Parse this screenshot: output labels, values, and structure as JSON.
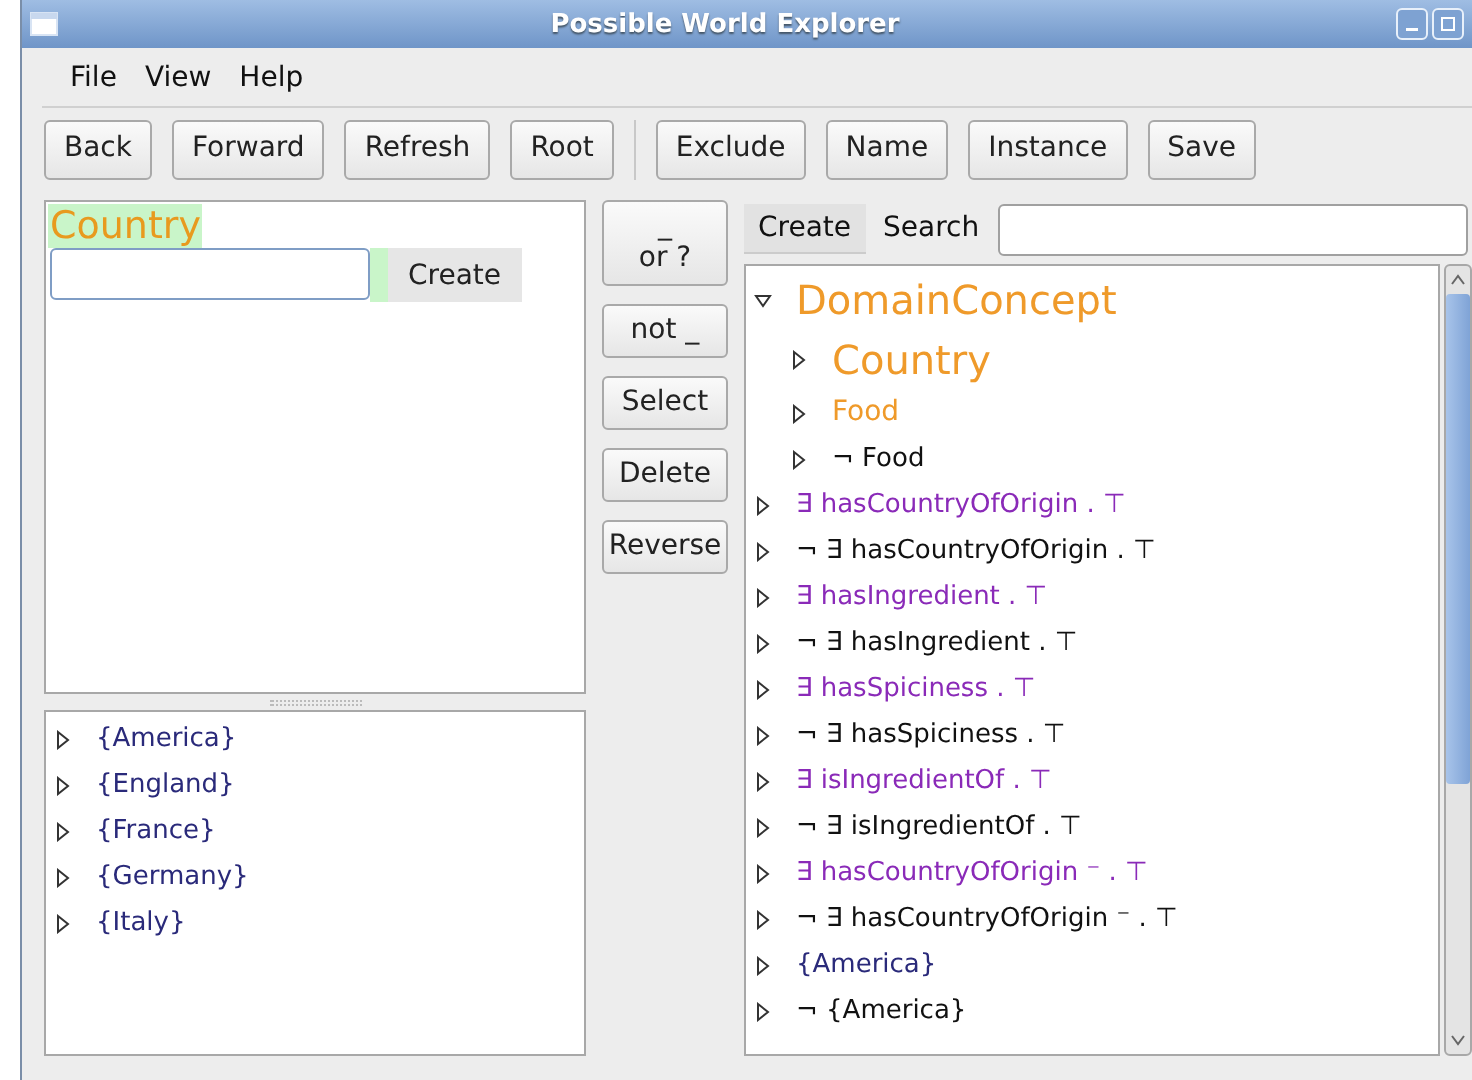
{
  "window": {
    "title": "Possible World Explorer"
  },
  "menu": [
    "File",
    "View",
    "Help"
  ],
  "toolbar": {
    "left": [
      "Back",
      "Forward",
      "Refresh",
      "Root"
    ],
    "right": [
      "Exclude",
      "Name",
      "Instance",
      "Save"
    ]
  },
  "editor": {
    "concept": "Country",
    "create_button": "Create"
  },
  "operators": [
    "_\nor ?",
    "not _",
    "Select",
    "Delete",
    "Reverse"
  ],
  "individuals": [
    {
      "label": "{America}",
      "expanded": false
    },
    {
      "label": "{England}",
      "expanded": false
    },
    {
      "label": "{France}",
      "expanded": false
    },
    {
      "label": "{Germany}",
      "expanded": false
    },
    {
      "label": "{Italy}",
      "expanded": false
    }
  ],
  "right_panel": {
    "tabs": [
      {
        "label": "Create",
        "selected": true
      },
      {
        "label": "Search",
        "selected": false
      }
    ],
    "tree": [
      {
        "label": "DomainConcept",
        "kind": "heading",
        "expanded": true,
        "children": [
          {
            "label": "Country",
            "kind": "heading",
            "expanded": false
          },
          {
            "label": "Food",
            "kind": "concept",
            "expanded": false
          },
          {
            "label": "¬  Food",
            "kind": "plain",
            "expanded": false
          }
        ]
      },
      {
        "label": "∃ hasCountryOfOrigin . ⊤",
        "kind": "property",
        "expanded": false
      },
      {
        "label": "¬  ∃ hasCountryOfOrigin . ⊤",
        "kind": "plain",
        "expanded": false
      },
      {
        "label": "∃ hasIngredient . ⊤",
        "kind": "property",
        "expanded": false
      },
      {
        "label": "¬  ∃ hasIngredient . ⊤",
        "kind": "plain",
        "expanded": false
      },
      {
        "label": "∃ hasSpiciness . ⊤",
        "kind": "property",
        "expanded": false
      },
      {
        "label": "¬  ∃ hasSpiciness . ⊤",
        "kind": "plain",
        "expanded": false
      },
      {
        "label": "∃ isIngredientOf . ⊤",
        "kind": "property",
        "expanded": false
      },
      {
        "label": "¬  ∃ isIngredientOf . ⊤",
        "kind": "plain",
        "expanded": false
      },
      {
        "label": "∃ hasCountryOfOrigin ⁻ . ⊤",
        "kind": "property",
        "expanded": false
      },
      {
        "label": "¬  ∃ hasCountryOfOrigin ⁻ . ⊤",
        "kind": "plain",
        "expanded": false
      },
      {
        "label": "{America}",
        "kind": "individual",
        "expanded": false
      },
      {
        "label": "¬  {America}",
        "kind": "plain",
        "expanded": false
      }
    ]
  }
}
